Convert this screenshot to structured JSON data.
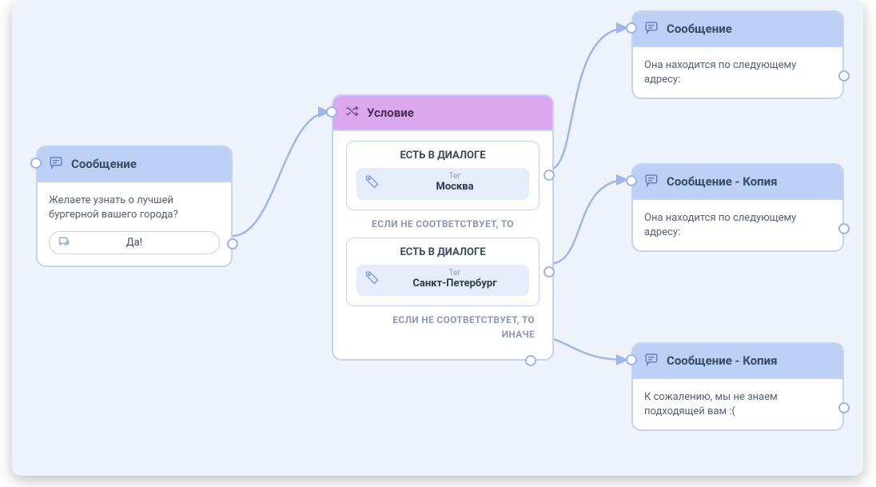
{
  "colors": {
    "canvas_bg": "#eef2fa",
    "node_border": "#c4d3f3",
    "header_blue": "#bcd0f5",
    "header_purple": "#dba8ef",
    "wire": "#9fb6e8"
  },
  "node1": {
    "title": "Сообщение",
    "message": "Желаете узнать о лучшей бургерной вашего города?",
    "reply": "Да!"
  },
  "condition": {
    "title": "Условие",
    "group1": {
      "header": "ЕСТЬ В ДИАЛОГЕ",
      "tag_label": "Тег",
      "tag_value": "Москва"
    },
    "else_label": "ЕСЛИ НЕ СООТВЕТСТВУЕТ, ТО",
    "group2": {
      "header": "ЕСТЬ В ДИАЛОГЕ",
      "tag_label": "Тег",
      "tag_value": "Санкт-Петербург"
    },
    "else_final_1": "ЕСЛИ НЕ СООТВЕТСТВУЕТ, ТО",
    "else_final_2": "ИНАЧЕ"
  },
  "node_r1": {
    "title": "Сообщение",
    "message": "Она находится по следующему адресу:"
  },
  "node_r2": {
    "title": "Сообщение - Копия",
    "message": "Она находится по следующему адресу:"
  },
  "node_r3": {
    "title": "Сообщение - Копия",
    "message": "К сожалению, мы не знаем подходящей вам :("
  }
}
